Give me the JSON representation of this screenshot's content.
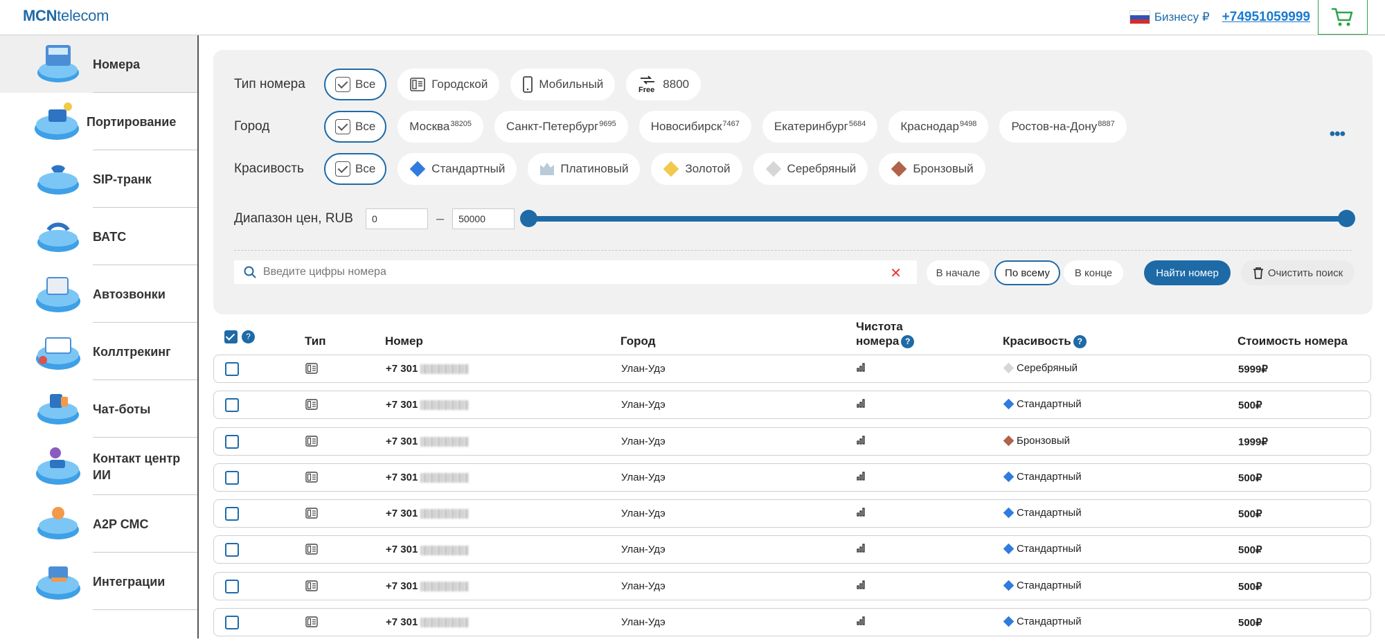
{
  "header": {
    "logo_bold": "MCN",
    "logo_rest": "telecom",
    "segment": "Бизнесу ₽",
    "phone": "+74951059999"
  },
  "sidebar": {
    "items": [
      {
        "label": "Номера",
        "icon": "numbers-icon"
      },
      {
        "label": "Портирование",
        "icon": "porting-icon"
      },
      {
        "label": "SIP-транк",
        "icon": "sip-trunk-icon"
      },
      {
        "label": "ВАТС",
        "icon": "vats-icon"
      },
      {
        "label": "Автозвонки",
        "icon": "autocall-icon"
      },
      {
        "label": "Коллтрекинг",
        "icon": "calltracking-icon"
      },
      {
        "label": "Чат-боты",
        "icon": "chatbot-icon"
      },
      {
        "label": "Контакт центр ИИ",
        "icon": "ai-contact-center-icon"
      },
      {
        "label": "A2P СМС",
        "icon": "a2p-sms-icon"
      },
      {
        "label": "Интеграции",
        "icon": "integrations-icon"
      }
    ]
  },
  "filters": {
    "type_label": "Тип номера",
    "type_options": [
      "Все",
      "Городской",
      "Мобильный",
      "8800"
    ],
    "city_label": "Город",
    "city_all": "Все",
    "cities": [
      {
        "name": "Москва",
        "count": "38205"
      },
      {
        "name": "Санкт-Петербург",
        "count": "9695"
      },
      {
        "name": "Новосибирск",
        "count": "7467"
      },
      {
        "name": "Екатеринбург",
        "count": "5684"
      },
      {
        "name": "Краснодар",
        "count": "9498"
      },
      {
        "name": "Ростов-на-Дону",
        "count": "8887"
      }
    ],
    "beauty_label": "Красивость",
    "beauty_all": "Все",
    "beauty_options": [
      "Стандартный",
      "Платиновый",
      "Золотой",
      "Серебряный",
      "Бронзовый"
    ],
    "price_label": "Диапазон цен, RUB",
    "price_min": "0",
    "price_max": "50000",
    "search_placeholder": "Введите цифры номера",
    "pos_start": "В начале",
    "pos_all": "По всему",
    "pos_end": "В конце",
    "find_label": "Найти номер",
    "clear_label": "Очистить поиск"
  },
  "table": {
    "col_type": "Тип",
    "col_number": "Номер",
    "col_city": "Город",
    "col_clean_1": "Чистота",
    "col_clean_2": "номера",
    "col_beauty": "Красивость",
    "col_cost": "Стоимость номера",
    "rows": [
      {
        "prefix": "+7 301",
        "city": "Улан-Удэ",
        "beauty": "Серебряный",
        "cost": "5999₽"
      },
      {
        "prefix": "+7 301",
        "city": "Улан-Удэ",
        "beauty": "Стандартный",
        "cost": "500₽"
      },
      {
        "prefix": "+7 301",
        "city": "Улан-Удэ",
        "beauty": "Бронзовый",
        "cost": "1999₽"
      },
      {
        "prefix": "+7 301",
        "city": "Улан-Удэ",
        "beauty": "Стандартный",
        "cost": "500₽"
      },
      {
        "prefix": "+7 301",
        "city": "Улан-Удэ",
        "beauty": "Стандартный",
        "cost": "500₽"
      },
      {
        "prefix": "+7 301",
        "city": "Улан-Удэ",
        "beauty": "Стандартный",
        "cost": "500₽"
      },
      {
        "prefix": "+7 301",
        "city": "Улан-Удэ",
        "beauty": "Стандартный",
        "cost": "500₽"
      },
      {
        "prefix": "+7 301",
        "city": "Улан-Удэ",
        "beauty": "Стандартный",
        "cost": "500₽"
      }
    ]
  },
  "colors": {
    "accent": "#1e6aa7",
    "standard": "#2f7be0",
    "platinum": "#b9cad8",
    "gold": "#f2c94c",
    "silver": "#d6d6d6",
    "bronze": "#b0624a",
    "cart_green": "#2aa44a"
  }
}
